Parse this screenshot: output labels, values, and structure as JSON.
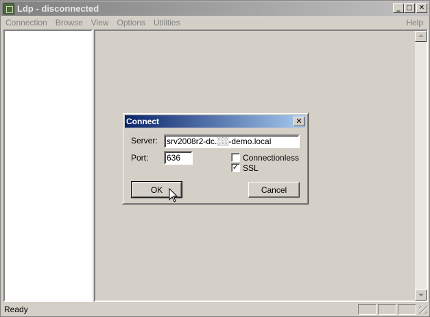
{
  "window": {
    "title": "Ldp - disconnected"
  },
  "menu": {
    "items": [
      "Connection",
      "Browse",
      "View",
      "Options",
      "Utilities"
    ],
    "help": "Help"
  },
  "status": {
    "text": "Ready"
  },
  "dialog": {
    "title": "Connect",
    "server_label": "Server:",
    "server_value": "srv2008r2-dc.░░-demo.local",
    "port_label": "Port:",
    "port_value": "636",
    "connectionless_label": "Connectionless",
    "connectionless_checked": false,
    "ssl_label": "SSL",
    "ssl_checked": true,
    "ok_label": "OK",
    "cancel_label": "Cancel"
  }
}
